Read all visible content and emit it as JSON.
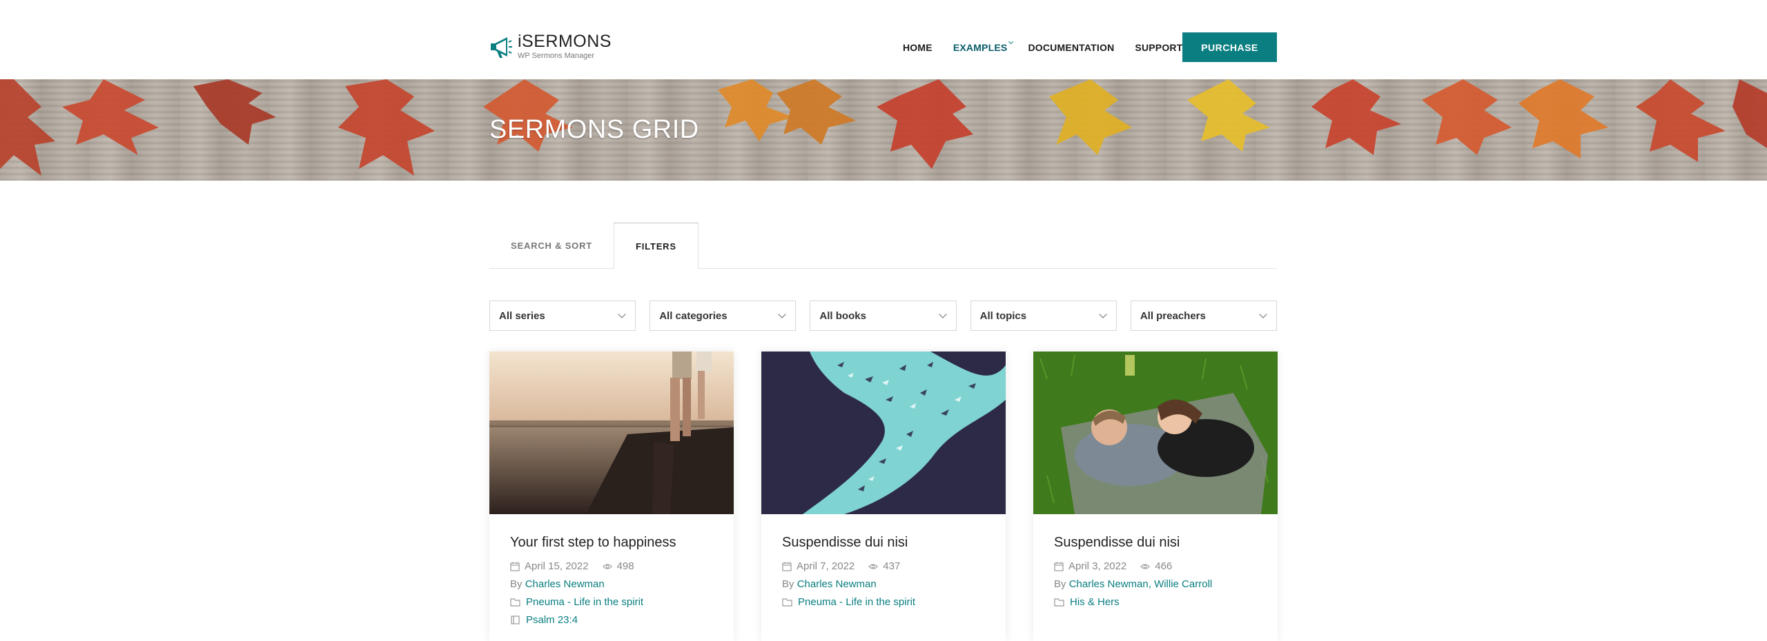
{
  "header": {
    "logo_title": "iSERMONS",
    "logo_subtitle": "WP Sermons Manager",
    "nav": [
      {
        "label": "HOME"
      },
      {
        "label": "EXAMPLES"
      },
      {
        "label": "DOCUMENTATION"
      },
      {
        "label": "SUPPORT"
      }
    ],
    "purchase_label": "PURCHASE"
  },
  "hero": {
    "title": "SERMONS GRID"
  },
  "tabs": [
    {
      "label": "SEARCH & SORT",
      "active": false
    },
    {
      "label": "FILTERS",
      "active": true
    }
  ],
  "filters": [
    {
      "value": "All series"
    },
    {
      "value": "All categories"
    },
    {
      "value": "All books"
    },
    {
      "value": "All topics"
    },
    {
      "value": "All preachers"
    }
  ],
  "cards": [
    {
      "title": "Your first step to happiness",
      "date": "April 15, 2022",
      "views": "498",
      "by_prefix": "By ",
      "preachers": "Charles Newman",
      "category": "Pneuma - Life in the spirit",
      "extra": "Psalm 23:4"
    },
    {
      "title": "Suspendisse dui nisi",
      "date": "April 7, 2022",
      "views": "437",
      "by_prefix": "By ",
      "preachers": "Charles Newman",
      "category": "Pneuma - Life in the spirit"
    },
    {
      "title": "Suspendisse dui nisi",
      "date": "April 3, 2022",
      "views": "466",
      "by_prefix": "By ",
      "preachers": "Charles Newman, Willie Carroll",
      "category": "His & Hers"
    }
  ],
  "colors": {
    "accent": "#0a7e80",
    "nav_active": "#0a5c6b",
    "text": "#222222",
    "muted": "#888888"
  },
  "icons": {
    "logo": "megaphone-icon",
    "date": "calendar-icon",
    "views": "eye-icon",
    "category": "folder-icon",
    "dropdown": "chevron-down-icon"
  }
}
